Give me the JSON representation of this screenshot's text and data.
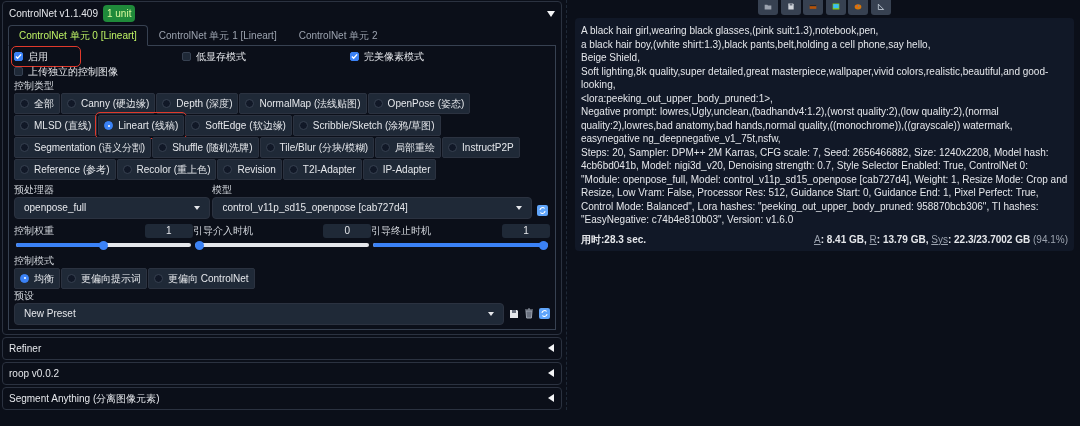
{
  "header": {
    "title": "ControlNet v1.1.409",
    "badge": "1 unit",
    "expanded": true
  },
  "tabs": [
    {
      "label": "ControlNet 单元 0 [Lineart]",
      "selected": true
    },
    {
      "label": "ControlNet 单元 1 [Lineart]",
      "selected": false
    },
    {
      "label": "ControlNet 单元 2",
      "selected": false
    }
  ],
  "checkboxes": [
    {
      "label": "启用",
      "checked": true,
      "highlighted": true
    },
    {
      "label": "低显存模式",
      "checked": false,
      "highlighted": false
    },
    {
      "label": "完美像素模式",
      "checked": true,
      "highlighted": false
    },
    {
      "label": "上传独立的控制图像",
      "checked": false,
      "highlighted": false
    }
  ],
  "control_type": {
    "label": "控制类型",
    "options": [
      {
        "label": "全部",
        "selected": false,
        "highlighted": false
      },
      {
        "label": "Canny (硬边缘)",
        "selected": false,
        "highlighted": false
      },
      {
        "label": "Depth (深度)",
        "selected": false,
        "highlighted": false
      },
      {
        "label": "NormalMap (法线贴图)",
        "selected": false,
        "highlighted": false
      },
      {
        "label": "OpenPose (姿态)",
        "selected": false,
        "highlighted": false
      },
      {
        "label": "MLSD (直线)",
        "selected": false,
        "highlighted": false
      },
      {
        "label": "Lineart (线稿)",
        "selected": true,
        "highlighted": true
      },
      {
        "label": "SoftEdge (软边缘)",
        "selected": false,
        "highlighted": false
      },
      {
        "label": "Scribble/Sketch (涂鸦/草图)",
        "selected": false,
        "highlighted": false
      },
      {
        "label": "Segmentation (语义分割)",
        "selected": false,
        "highlighted": false
      },
      {
        "label": "Shuffle (随机洗牌)",
        "selected": false,
        "highlighted": false
      },
      {
        "label": "Tile/Blur (分块/模糊)",
        "selected": false,
        "highlighted": false
      },
      {
        "label": "局部重绘",
        "selected": false,
        "highlighted": false
      },
      {
        "label": "InstructP2P",
        "selected": false,
        "highlighted": false
      },
      {
        "label": "Reference (参考)",
        "selected": false,
        "highlighted": false
      },
      {
        "label": "Recolor (重上色)",
        "selected": false,
        "highlighted": false
      },
      {
        "label": "Revision",
        "selected": false,
        "highlighted": false
      },
      {
        "label": "T2I-Adapter",
        "selected": false,
        "highlighted": false
      },
      {
        "label": "IP-Adapter",
        "selected": false,
        "highlighted": false
      }
    ]
  },
  "preprocessor": {
    "label": "预处理器",
    "value": "openpose_full"
  },
  "model": {
    "label": "模型",
    "value": "control_v11p_sd15_openpose [cab727d4]"
  },
  "sliders": [
    {
      "label": "控制权重",
      "reading": "1",
      "level": 0.5
    },
    {
      "label": "引导介入时机",
      "reading": "0",
      "level": 0
    },
    {
      "label": "引导终止时机",
      "reading": "1",
      "level": 1
    }
  ],
  "control_mode": {
    "label": "控制模式",
    "options": [
      {
        "label": "均衡",
        "selected": true
      },
      {
        "label": "更偏向提示词",
        "selected": false
      },
      {
        "label": "更偏向 ControlNet",
        "selected": false
      }
    ]
  },
  "preset": {
    "label": "预设",
    "value": "New Preset"
  },
  "sections": [
    {
      "title": "Refiner",
      "expanded": false
    },
    {
      "title": "roop v0.0.2",
      "expanded": false
    },
    {
      "title": "Segment Anything (分离图像元素)",
      "expanded": false
    }
  ],
  "output": {
    "prompt_lines": [
      "A black hair girl,wearing black glasses,(pink suit:1.3),notebook,pen,",
      "a black hair boy,(white shirt:1.3),black pants,belt,holding a cell phone,say hello,",
      "Beige Shield,",
      "Soft lighting,8k quality,super detailed,great masterpiece,wallpaper,vivid colors,realistic,beautiful,and good-looking,",
      "<lora:peeking_out_upper_body_pruned:1>,",
      "Negative prompt: lowres,Ugly,unclean,(badhandv4:1.2),(worst quality:2),(low quality:2),(normal quality:2),lowres,bad anatomy,bad hands,normal quality,((monochrome)),((grayscale)) watermark,",
      "easynegative ng_deepnegative_v1_75t,nsfw,",
      "Steps: 20, Sampler: DPM++ 2M Karras, CFG scale: 7, Seed: 2656466882, Size: 1240x2208, Model hash: 4cb6bd041b, Model: nigi3d_v20, Denoising strength: 0.7, Style Selector Enabled: True, ControlNet 0: \"Module: openpose_full, Model: control_v11p_sd15_openpose [cab727d4], Weight: 1, Resize Mode: Crop and Resize, Low Vram: False, Processor Res: 512, Guidance Start: 0, Guidance End: 1, Pixel Perfect: True, Control Mode: Balanced\", Lora hashes: \"peeking_out_upper_body_pruned: 958870bcb306\", TI hashes: \"EasyNegative: c74b4e810b03\", Version: v1.6.0"
    ],
    "time": "用时:28.3 sec.",
    "memory": [
      {
        "label": "A",
        "value": ": 8.41 GB,"
      },
      {
        "label": "R",
        "value": ": 13.79 GB,"
      },
      {
        "label": "Sys",
        "value": ": 22.3/23.7002 GB"
      }
    ],
    "memory_percent": "(94.1%)"
  }
}
